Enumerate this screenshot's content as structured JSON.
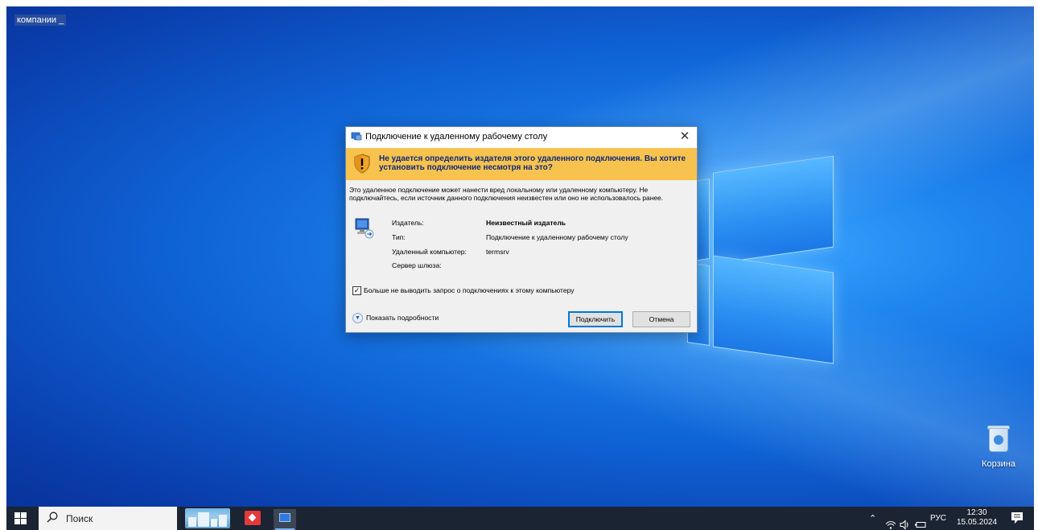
{
  "desktop": {
    "top_caption": "компании _",
    "recycle_bin_label": "Корзина"
  },
  "dialog": {
    "title": "Подключение к удаленному рабочему столу",
    "close_glyph": "✕",
    "warning": "Не удается определить издателя этого удаленного подключения. Вы хотите установить подключение несмотря на это?",
    "body": "Это удаленное подключение может нанести вред локальному или удаленному компьютеру. Не подключайтесь, если источник данного подключения неизвестен или оно не использовалось ранее.",
    "fields": {
      "publisher_label": "Издатель:",
      "publisher_value": "Неизвестный издатель",
      "type_label": "Тип:",
      "type_value": "Подключение к удаленному рабочему столу",
      "remote_label": "Удаленный компьютер:",
      "remote_value": "termsrv",
      "gateway_label": "Сервер шлюза:"
    },
    "checkbox_label": "Больше не выводить запрос о подключениях к этому компьютеру",
    "checkbox_checked": true,
    "checkbox_mark": "✓",
    "details_label": "Показать подробности",
    "details_glyph": "▼",
    "connect_label": "Подключить",
    "cancel_label": "Отмена"
  },
  "taskbar": {
    "search_placeholder": "Поиск",
    "tray_up_glyph": "⌃",
    "language": "РУС",
    "time": "12:30",
    "date": "15.05.2024"
  },
  "colors": {
    "warning_band": "#f7c24d",
    "warning_text": "#0f2a78",
    "taskbar": "#1b2432",
    "accent": "#0078d7"
  },
  "icons": [
    "windows-start-icon",
    "search-icon",
    "rdp-icon",
    "shield-warning-icon",
    "computer-icon",
    "recycle-bin-icon",
    "wifi-icon",
    "volume-icon",
    "battery-icon",
    "notification-icon"
  ]
}
